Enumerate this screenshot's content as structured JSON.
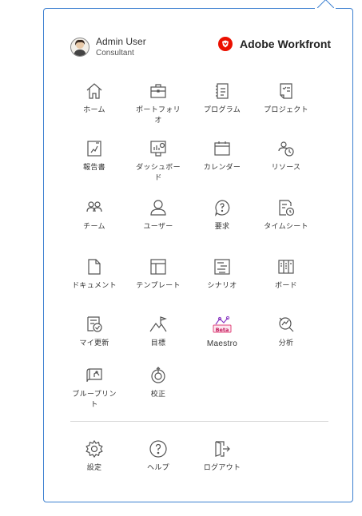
{
  "user": {
    "name": "Admin User",
    "role": "Consultant"
  },
  "brand": {
    "name": "Adobe Workfront",
    "color": "#eb1000"
  },
  "accent": "#3b7fd0",
  "menu": [
    {
      "label": "ホーム",
      "icon": "home-icon"
    },
    {
      "label": "ポートフォリオ",
      "icon": "briefcase-icon"
    },
    {
      "label": "プログラム",
      "icon": "program-icon"
    },
    {
      "label": "プロジェクト",
      "icon": "project-icon"
    },
    {
      "label": "報告書",
      "icon": "report-icon"
    },
    {
      "label": "ダッシュボード",
      "icon": "dashboard-icon"
    },
    {
      "label": "カレンダー",
      "icon": "calendar-icon"
    },
    {
      "label": "リソース",
      "icon": "resources-icon"
    },
    {
      "label": "チーム",
      "icon": "team-icon"
    },
    {
      "label": "ユーザー",
      "icon": "user-icon"
    },
    {
      "label": "要求",
      "icon": "request-icon"
    },
    {
      "label": "タイムシート",
      "icon": "timesheet-icon"
    },
    {
      "label": "ドキュメント",
      "icon": "document-icon"
    },
    {
      "label": "テンプレート",
      "icon": "template-icon"
    },
    {
      "label": "シナリオ",
      "icon": "scenario-icon"
    },
    {
      "label": "ボード",
      "icon": "board-icon"
    },
    {
      "label": "マイ更新",
      "icon": "my-updates-icon"
    },
    {
      "label": "目標",
      "icon": "goals-icon"
    },
    {
      "label": "Maestro",
      "icon": "maestro-icon",
      "badge": "Beta"
    },
    {
      "label": "分析",
      "icon": "analytics-icon"
    },
    {
      "label": "ブループリント",
      "icon": "blueprint-icon"
    },
    {
      "label": "校正",
      "icon": "proof-icon"
    }
  ],
  "footer": [
    {
      "label": "設定",
      "icon": "gear-icon"
    },
    {
      "label": "ヘルプ",
      "icon": "help-icon"
    },
    {
      "label": "ログアウト",
      "icon": "logout-icon"
    }
  ]
}
